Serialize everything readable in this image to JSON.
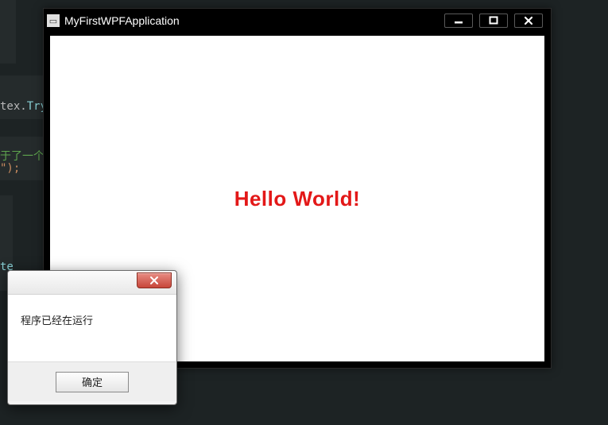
{
  "background_code": {
    "line1_prefix": "tex",
    "line1_dot": ".",
    "line1_try": "Try",
    "line2a": "于了一个",
    "line2b": "\");",
    "line3": "te"
  },
  "main_window": {
    "title": "MyFirstWPFApplication",
    "content_text": "Hello World!"
  },
  "messagebox": {
    "body_text": "程序已经在运行",
    "ok_label": "确定"
  }
}
